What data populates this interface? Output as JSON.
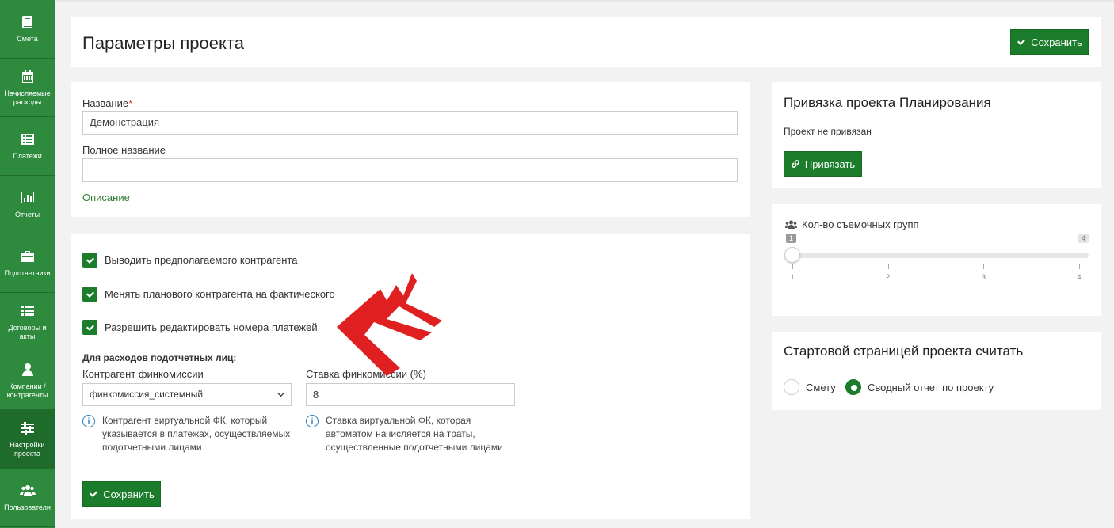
{
  "sidebar": {
    "items": [
      {
        "label": "Смета",
        "icon": "book-icon"
      },
      {
        "label": "Начисляемые расходы",
        "icon": "calendar-icon"
      },
      {
        "label": "Платежи",
        "icon": "list-icon"
      },
      {
        "label": "Отчеты",
        "icon": "bar-chart-icon"
      },
      {
        "label": "Подотчетники",
        "icon": "briefcase-icon"
      },
      {
        "label": "Договоры и акты",
        "icon": "list-lines-icon"
      },
      {
        "label": "Компании / контрагенты",
        "icon": "user-icon"
      },
      {
        "label": "Настройки проекта",
        "icon": "sliders-icon"
      },
      {
        "label": "Пользователи",
        "icon": "users-icon"
      }
    ],
    "active_index": 7
  },
  "header": {
    "title": "Параметры проекта",
    "save_label": "Сохранить"
  },
  "name_card": {
    "name_label": "Название",
    "name_required": "*",
    "name_value": "Демонстрация",
    "fullname_label": "Полное название",
    "fullname_value": "",
    "description_link": "Описание"
  },
  "settings": {
    "checkboxes": [
      {
        "label": "Выводить предполагаемого контрагента",
        "checked": true
      },
      {
        "label": "Менять планового контрагента на фактического",
        "checked": true
      },
      {
        "label": "Разрешить редактировать номера платежей",
        "checked": true
      }
    ],
    "subtitle": "Для расходов подотчетных лиц:",
    "contractor_label": "Контрагент финкомиссии",
    "contractor_value": "финкомиссия_системный",
    "rate_label": "Ставка финкомиссии (%)",
    "rate_value": "8",
    "contractor_hint": "Контрагент виртуальной ФК, который указывается в платежах, осуществляемых подотчетными лицами",
    "rate_hint": "Ставка виртуальной ФК, которая автоматом начисляется на траты, осуществленные подотчетными лицами",
    "save_label": "Сохранить"
  },
  "binding": {
    "title": "Привязка проекта Планирования",
    "status": "Проект не привязан",
    "bind_label": "Привязать"
  },
  "crews": {
    "title": "Кол-во съемочных групп",
    "min_badge": "1",
    "max_badge": "4",
    "value": 1,
    "min": 1,
    "max": 4,
    "ticks": [
      "1",
      "2",
      "3",
      "4"
    ]
  },
  "start_page": {
    "title": "Стартовой страницей проекта считать",
    "options": [
      {
        "label": "Смету",
        "selected": false
      },
      {
        "label": "Сводный отчет по проекту",
        "selected": true
      }
    ]
  },
  "colors": {
    "primary": "#1b7d2b",
    "sidebar": "#2e8b3e",
    "arrows": "#e02020"
  }
}
